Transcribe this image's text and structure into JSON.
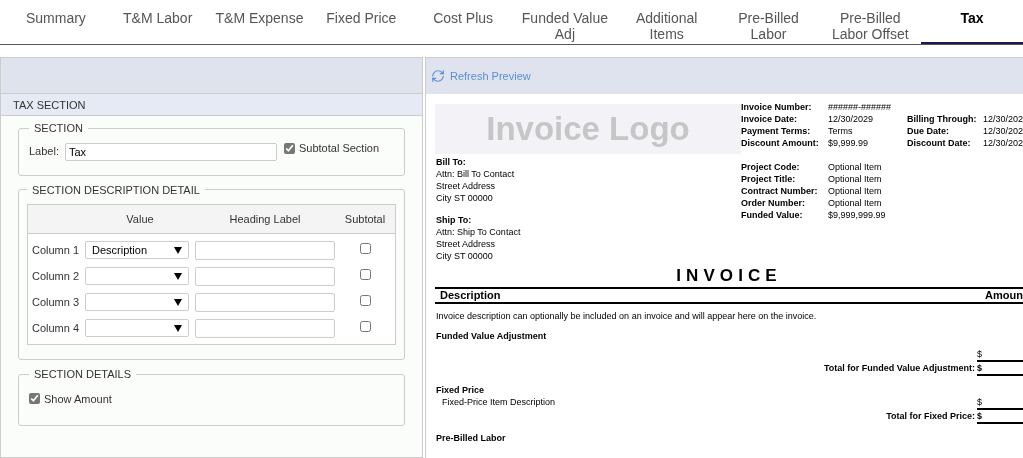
{
  "tabs": [
    {
      "label": "Summary",
      "selected": false
    },
    {
      "label": "T&M Labor",
      "selected": false
    },
    {
      "label": "T&M Expense",
      "selected": false
    },
    {
      "label": "Fixed Price",
      "selected": false
    },
    {
      "label": "Cost Plus",
      "selected": false
    },
    {
      "label": "Funded Value Adj",
      "selected": false
    },
    {
      "label": "Additional Items",
      "selected": false
    },
    {
      "label": "Pre-Billed Labor",
      "selected": false
    },
    {
      "label": "Pre-Billed Labor Offset",
      "selected": false
    },
    {
      "label": "Tax",
      "selected": true
    }
  ],
  "editor": {
    "title": "TAX SECTION",
    "section": {
      "legend": "SECTION",
      "label": "Label:",
      "value": "Tax",
      "subtotal": {
        "label": "Subtotal Section",
        "checked": true
      }
    },
    "description_detail": {
      "legend": "SECTION DESCRIPTION DETAIL",
      "columns": [
        "Value",
        "Heading Label",
        "Subtotal"
      ],
      "rows": [
        {
          "label": "Column 1",
          "value": "Description",
          "subtotal": false
        },
        {
          "label": "Column 2",
          "subtotal": false
        },
        {
          "label": "Column 3",
          "subtotal": false
        },
        {
          "label": "Column 4",
          "subtotal": false
        }
      ]
    },
    "details": {
      "legend": "SECTION DETAILS",
      "show_amount": {
        "label": "Show Amount",
        "checked": true
      }
    }
  },
  "preview": {
    "refresh": "Refresh Preview",
    "logo": "Invoice Logo",
    "bill_to": {
      "title": "Bill To:",
      "lines": [
        "Attn: Bill To Contact",
        "Street Address",
        "City ST 00000"
      ]
    },
    "ship_to": {
      "title": "Ship To:",
      "lines": [
        "Attn: Ship To Contact",
        "Street Address",
        "City ST 00000"
      ]
    },
    "info": [
      {
        "label": "Invoice Number:",
        "value": "######-######"
      },
      {
        "label": "Invoice Date:",
        "value": "12/30/2029"
      },
      {
        "label": "Payment Terms:",
        "value": "Terms"
      },
      {
        "label": "Discount Amount:",
        "value": "$9,999.99"
      }
    ],
    "info_right": [
      {
        "label": "Billing Through:",
        "value": "12/30/202"
      },
      {
        "label": "Due Date:",
        "value": "12/30/202"
      },
      {
        "label": "Discount Date:",
        "value": "12/30/202"
      }
    ],
    "project": [
      {
        "label": "Project Code:",
        "value": "Optional Item"
      },
      {
        "label": "Project Title:",
        "value": "Optional Item"
      },
      {
        "label": "Contract Number:",
        "value": "Optional Item"
      },
      {
        "label": "Order Number:",
        "value": "Optional Item"
      },
      {
        "label": "Funded Value:",
        "value": "$9,999,999.99"
      }
    ],
    "title": "INVOICE",
    "columns": [
      "Description",
      "Amoun"
    ],
    "note": "Invoice description can optionally be included on an invoice and will appear here on the invoice.",
    "sections": [
      {
        "title": "Funded Value Adjustment",
        "items": [
          {
            "currency": "$"
          }
        ],
        "total_label": "Total for Funded Value Adjustment:",
        "total_currency": "$"
      },
      {
        "title": "Fixed Price",
        "items": [
          {
            "description": "Fixed-Price Item Description",
            "currency": "$"
          }
        ],
        "total_label": "Total for Fixed Price:",
        "total_currency": "$"
      },
      {
        "title": "Pre-Billed Labor"
      }
    ]
  }
}
